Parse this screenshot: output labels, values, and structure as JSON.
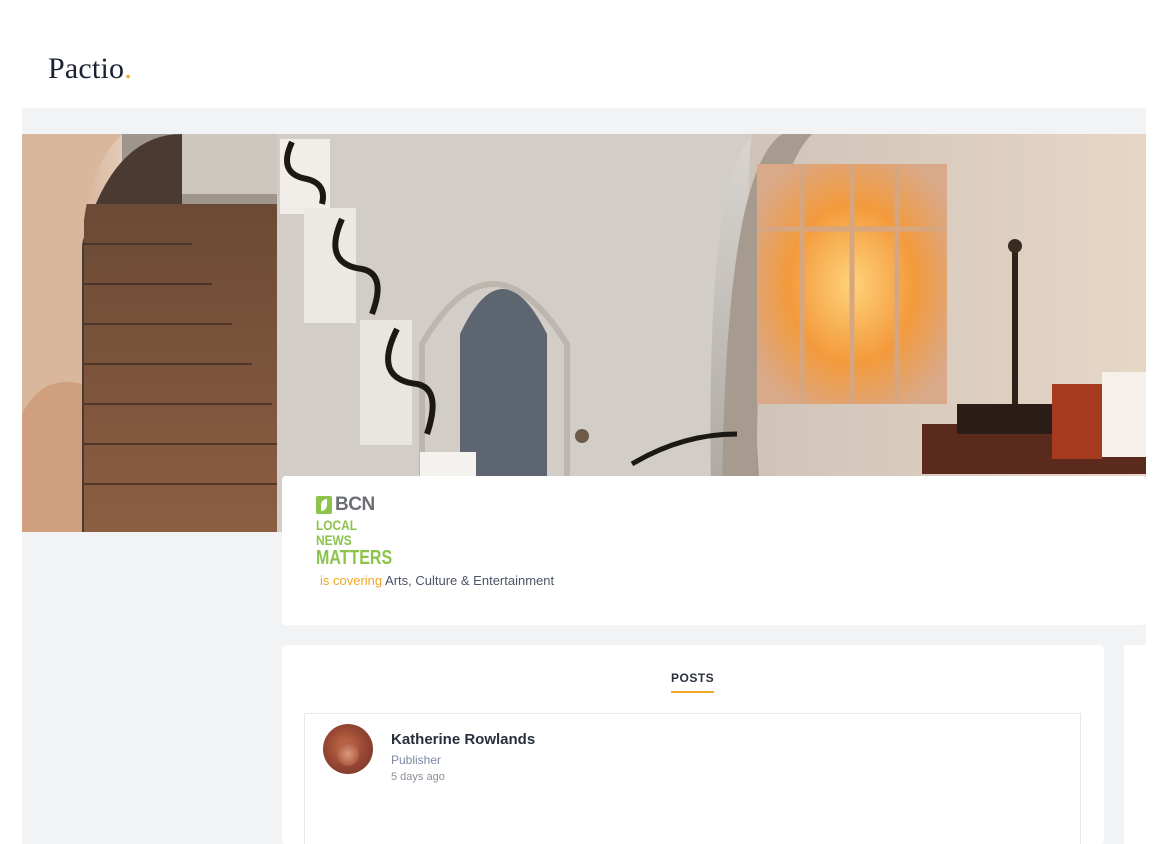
{
  "header": {
    "logo_text": "Pactio",
    "logo_dot": "."
  },
  "profile": {
    "brand_top": "BCN",
    "brand_line1": "LOCAL NEWS",
    "brand_line2": "MATTERS",
    "covering_prefix": "is covering",
    "covering_topic": "Arts, Culture & Entertainment"
  },
  "tabs": [
    {
      "label": "POSTS",
      "active": true
    }
  ],
  "posts": [
    {
      "author": "Katherine Rowlands",
      "role": "Publisher",
      "time": "5 days ago"
    }
  ],
  "colors": {
    "accent": "#f0a626",
    "brand_green": "#8cc34a",
    "background": "#f2f3f5"
  }
}
